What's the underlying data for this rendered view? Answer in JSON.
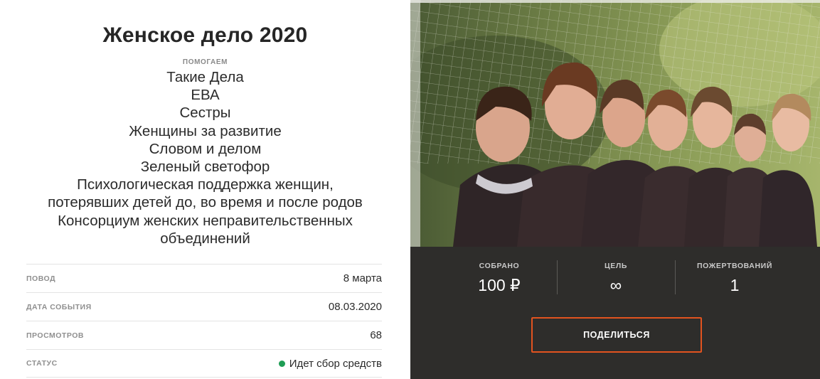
{
  "campaign": {
    "title": "Женское дело 2020",
    "help_label": "ПОМОГАЕМ",
    "beneficiaries": [
      "Такие Дела",
      "ЕВА",
      "Сестры",
      "Женщины за развитие",
      "Словом и делом",
      "Зеленый светофор",
      "Психологическая поддержка женщин,",
      "потерявших детей до, во время и после родов",
      "Консорциум женских неправительственных",
      "объединений"
    ]
  },
  "info": {
    "rows": [
      {
        "label": "ПОВОД",
        "value": "8 марта"
      },
      {
        "label": "ДАТА СОБЫТИЯ",
        "value": "08.03.2020"
      },
      {
        "label": "ПРОСМОТРОВ",
        "value": "68"
      },
      {
        "label": "СТАТУС",
        "value": "Идет сбор средств"
      }
    ],
    "status_color": "#1f9d55"
  },
  "stats": {
    "raised_label": "СОБРАНО",
    "raised_value": "100 ₽",
    "goal_label": "ЦЕЛЬ",
    "goal_value": "∞",
    "donations_label": "ПОЖЕРТВОВАНИЙ",
    "donations_value": "1"
  },
  "share": {
    "label": "ПОДЕЛИТЬСЯ",
    "accent": "#e2531f"
  },
  "colors": {
    "panel_bg": "#2e2d2b",
    "text": "#2b2b2b"
  }
}
